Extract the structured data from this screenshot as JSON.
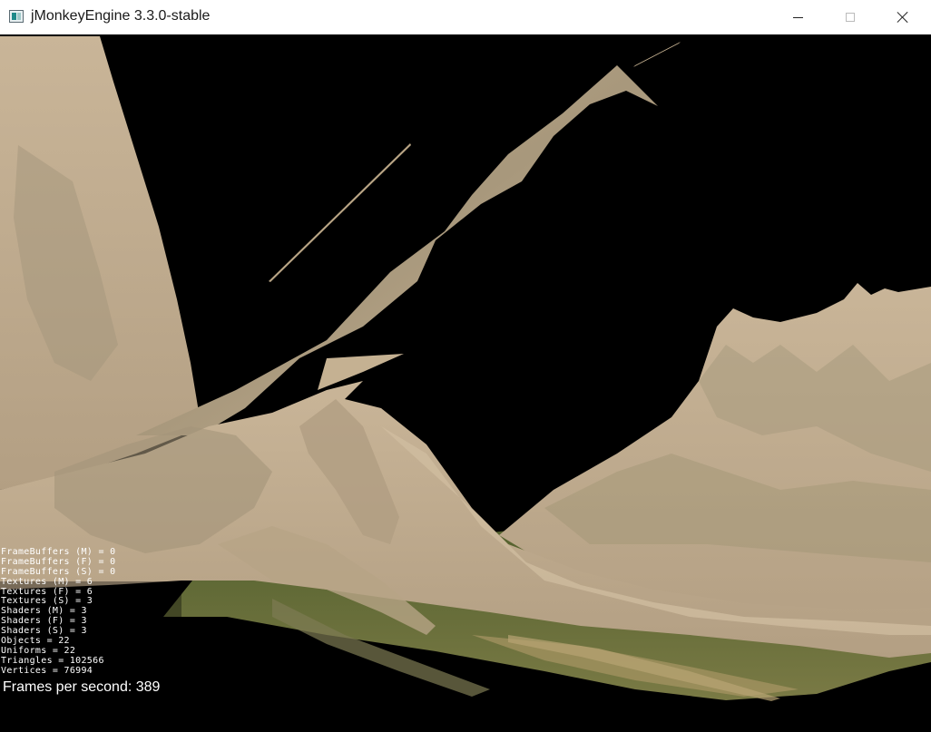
{
  "window": {
    "title": "jMonkeyEngine 3.3.0-stable",
    "controls": {
      "minimize_icon": "minimize-icon",
      "maximize_icon": "maximize-icon",
      "close_icon": "close-icon"
    }
  },
  "scene": {
    "background_color": "#000000",
    "terrain_color": "#c2ae92",
    "grass_color": "#5d6a3a"
  },
  "stats": {
    "items": [
      "FrameBuffers (M) = 0",
      "FrameBuffers (F) = 0",
      "FrameBuffers (S) = 0",
      "Textures (M) = 6",
      "Textures (F) = 6",
      "Textures (S) = 3",
      "Shaders (M) = 3",
      "Shaders (F) = 3",
      "Shaders (S) = 3",
      "Objects = 22",
      "Uniforms = 22",
      "Triangles = 102566",
      "Vertices = 76994"
    ],
    "fps": "Frames per second: 389"
  }
}
